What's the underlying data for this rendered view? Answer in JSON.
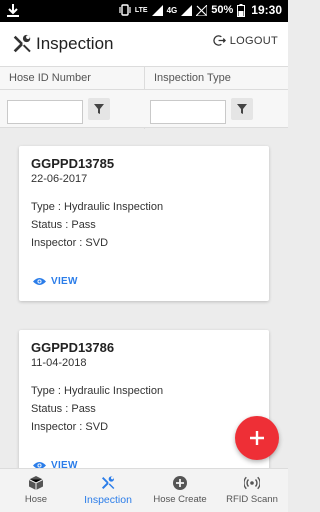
{
  "status_bar": {
    "network": "4G",
    "battery": "50%",
    "time": "19:30",
    "lte": "LTE"
  },
  "app_bar": {
    "title": "Inspection",
    "logout_label": "LOGOUT"
  },
  "table_header": {
    "col1": "Hose ID Number",
    "col2": "Inspection Type"
  },
  "filters": {
    "hose_id_value": "",
    "inspection_type_value": ""
  },
  "cards": [
    {
      "hose_id": "GGPPD13785",
      "date": "22-06-2017",
      "type": "Type : Hydraulic Inspection",
      "status": "Status : Pass",
      "inspector": "Inspector : SVD",
      "view_label": "VIEW"
    },
    {
      "hose_id": "GGPPD13786",
      "date": "11-04-2018",
      "type": "Type : Hydraulic Inspection",
      "status": "Status : Pass",
      "inspector": "Inspector : SVD",
      "view_label": "VIEW"
    }
  ],
  "bottom_nav": [
    {
      "label": "Hose",
      "icon": "cube-icon"
    },
    {
      "label": "Inspection",
      "icon": "tools-icon",
      "active": true
    },
    {
      "label": "Hose Create",
      "icon": "add-circle-icon"
    },
    {
      "label": "RFID Scann",
      "icon": "rfid-icon"
    }
  ],
  "colors": {
    "accent": "#2b7de9",
    "fab": "#ee2f36"
  }
}
